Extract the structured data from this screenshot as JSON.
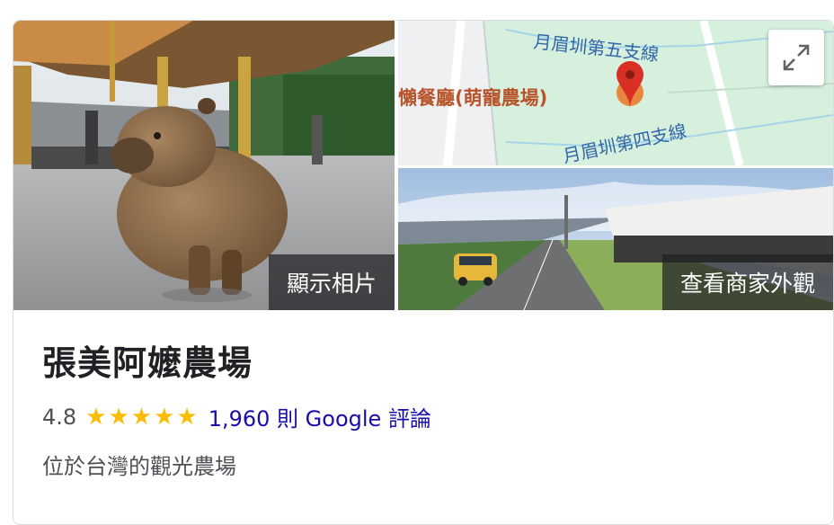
{
  "photos": {
    "main_label": "顯示相片",
    "street_label": "查看商家外觀"
  },
  "map": {
    "road_top": "月眉圳第五支線",
    "road_bottom": "月眉圳第四支線",
    "place_label": "懶餐廳(萌寵農場)",
    "pin_color": "#d93025",
    "land_color": "#d6f0dd"
  },
  "place": {
    "name": "張美阿嬤農場",
    "rating": "4.8",
    "stars": "★★★★★",
    "reviews": "1,960 則 Google 評論",
    "category": "位於台灣的觀光農場"
  },
  "colors": {
    "star": "#fbbc04",
    "link": "#1a0dab"
  }
}
